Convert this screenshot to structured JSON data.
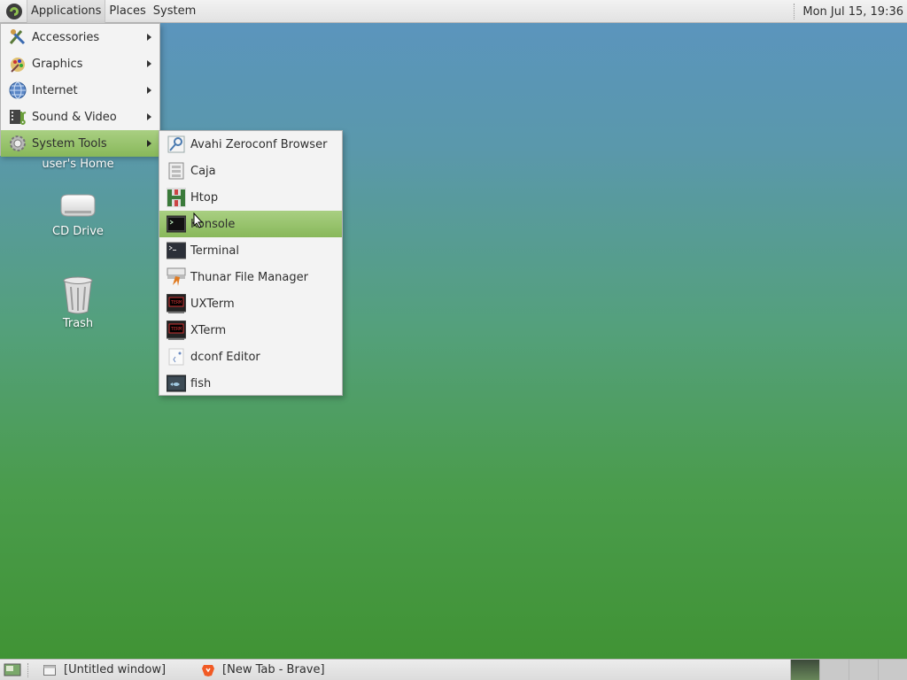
{
  "top_panel": {
    "menus": [
      {
        "label": "Applications"
      },
      {
        "label": "Places"
      },
      {
        "label": "System"
      }
    ],
    "clock": "Mon Jul 15, 19:36"
  },
  "desktop_icons": [
    {
      "label": "user's Home",
      "icon": "home-folder-icon"
    },
    {
      "label": "CD Drive",
      "icon": "cd-drive-icon"
    },
    {
      "label": "Trash",
      "icon": "trash-icon"
    }
  ],
  "applications_menu": {
    "items": [
      {
        "label": "Accessories",
        "icon": "accessories-icon"
      },
      {
        "label": "Graphics",
        "icon": "graphics-icon"
      },
      {
        "label": "Internet",
        "icon": "internet-icon"
      },
      {
        "label": "Sound & Video",
        "icon": "sound-video-icon"
      },
      {
        "label": "System Tools",
        "icon": "system-tools-icon",
        "highlighted": true
      }
    ]
  },
  "system_tools_menu": {
    "items": [
      {
        "label": "Avahi Zeroconf Browser",
        "icon": "avahi-icon"
      },
      {
        "label": "Caja",
        "icon": "caja-icon"
      },
      {
        "label": "Htop",
        "icon": "htop-icon"
      },
      {
        "label": "Konsole",
        "icon": "konsole-icon",
        "highlighted": true
      },
      {
        "label": "Terminal",
        "icon": "terminal-icon"
      },
      {
        "label": "Thunar File Manager",
        "icon": "thunar-icon"
      },
      {
        "label": "UXTerm",
        "icon": "uxterm-icon"
      },
      {
        "label": "XTerm",
        "icon": "xterm-icon"
      },
      {
        "label": "dconf Editor",
        "icon": "dconf-icon"
      },
      {
        "label": "fish",
        "icon": "fish-icon"
      }
    ]
  },
  "bottom_panel": {
    "tasks": [
      {
        "label": "[Untitled window]",
        "icon": "window-icon"
      },
      {
        "label": "[New Tab - Brave]",
        "icon": "brave-icon"
      }
    ],
    "workspace_count": 4,
    "active_workspace": 1
  },
  "colors": {
    "highlight": "#94c166",
    "panel": "#e6e6e6",
    "desktop_top": "#5b94c0",
    "desktop_bottom": "#3f9232"
  }
}
